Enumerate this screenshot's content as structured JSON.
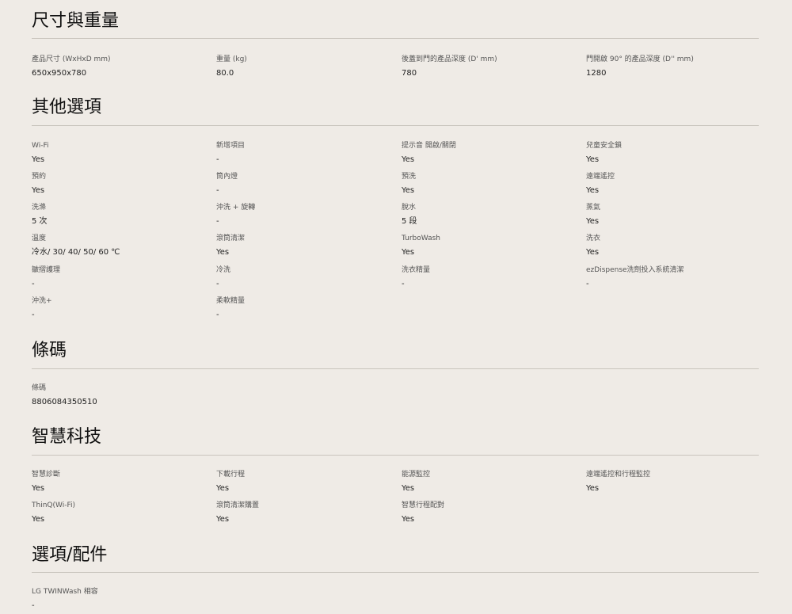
{
  "sections": {
    "dimensions": {
      "title": "尺寸與重量",
      "specs": [
        {
          "label": "產品尺寸 (WxHxD mm)",
          "value": "650x950x780"
        },
        {
          "label": "重量 (kg)",
          "value": "80.0"
        },
        {
          "label": "後蓋到門的產品深度 (D' mm)",
          "value": "780"
        },
        {
          "label": "門開啟 90° 的產品深度 (D'' mm)",
          "value": "1280"
        }
      ]
    },
    "options": {
      "title": "其他選項",
      "specs": [
        {
          "label": "Wi-Fi",
          "value": "Yes"
        },
        {
          "label": "新增項目",
          "value": "-"
        },
        {
          "label": "提示音 開啟/關閉",
          "value": "Yes"
        },
        {
          "label": "兒童安全鎖",
          "value": "Yes"
        },
        {
          "label": "預約",
          "value": "Yes"
        },
        {
          "label": "筒內燈",
          "value": "-"
        },
        {
          "label": "預洗",
          "value": "Yes"
        },
        {
          "label": "遠端遙控",
          "value": "Yes"
        },
        {
          "label": "洗滌",
          "value": "5 次"
        },
        {
          "label": "沖洗 + 旋轉",
          "value": "-"
        },
        {
          "label": "脫水",
          "value": "5 段"
        },
        {
          "label": "蒸氣",
          "value": "Yes"
        },
        {
          "label": "溫度",
          "value": "冷水/ 30/ 40/ 50/ 60 ℃"
        },
        {
          "label": "滾筒清潔",
          "value": "Yes"
        },
        {
          "label": "TurboWash",
          "value": "Yes"
        },
        {
          "label": "洗衣",
          "value": "Yes"
        },
        {
          "label": "皺摺護理",
          "value": "-"
        },
        {
          "label": "冷洗",
          "value": "-"
        },
        {
          "label": "洗衣精量",
          "value": "-"
        },
        {
          "label": "ezDispense洗劑投入系統清潔",
          "value": "-"
        },
        {
          "label": "沖洗+",
          "value": "-"
        },
        {
          "label": "柔軟精量",
          "value": "-"
        }
      ]
    },
    "barcode": {
      "title": "條碼",
      "specs": [
        {
          "label": "條碼",
          "value": "8806084350510"
        }
      ]
    },
    "smart": {
      "title": "智慧科技",
      "specs": [
        {
          "label": "智慧診斷",
          "value": "Yes"
        },
        {
          "label": "下載行程",
          "value": "Yes"
        },
        {
          "label": "能源監控",
          "value": "Yes"
        },
        {
          "label": "遠端遙控和行程監控",
          "value": "Yes"
        },
        {
          "label": "ThinQ(Wi-Fi)",
          "value": "Yes"
        },
        {
          "label": "滾筒清潔購置",
          "value": "Yes"
        },
        {
          "label": "智慧行程配對",
          "value": "Yes"
        }
      ]
    },
    "accessories": {
      "title": "選項/配件",
      "specs": [
        {
          "label": "LG TWINWash 相容",
          "value": "-"
        }
      ]
    }
  }
}
